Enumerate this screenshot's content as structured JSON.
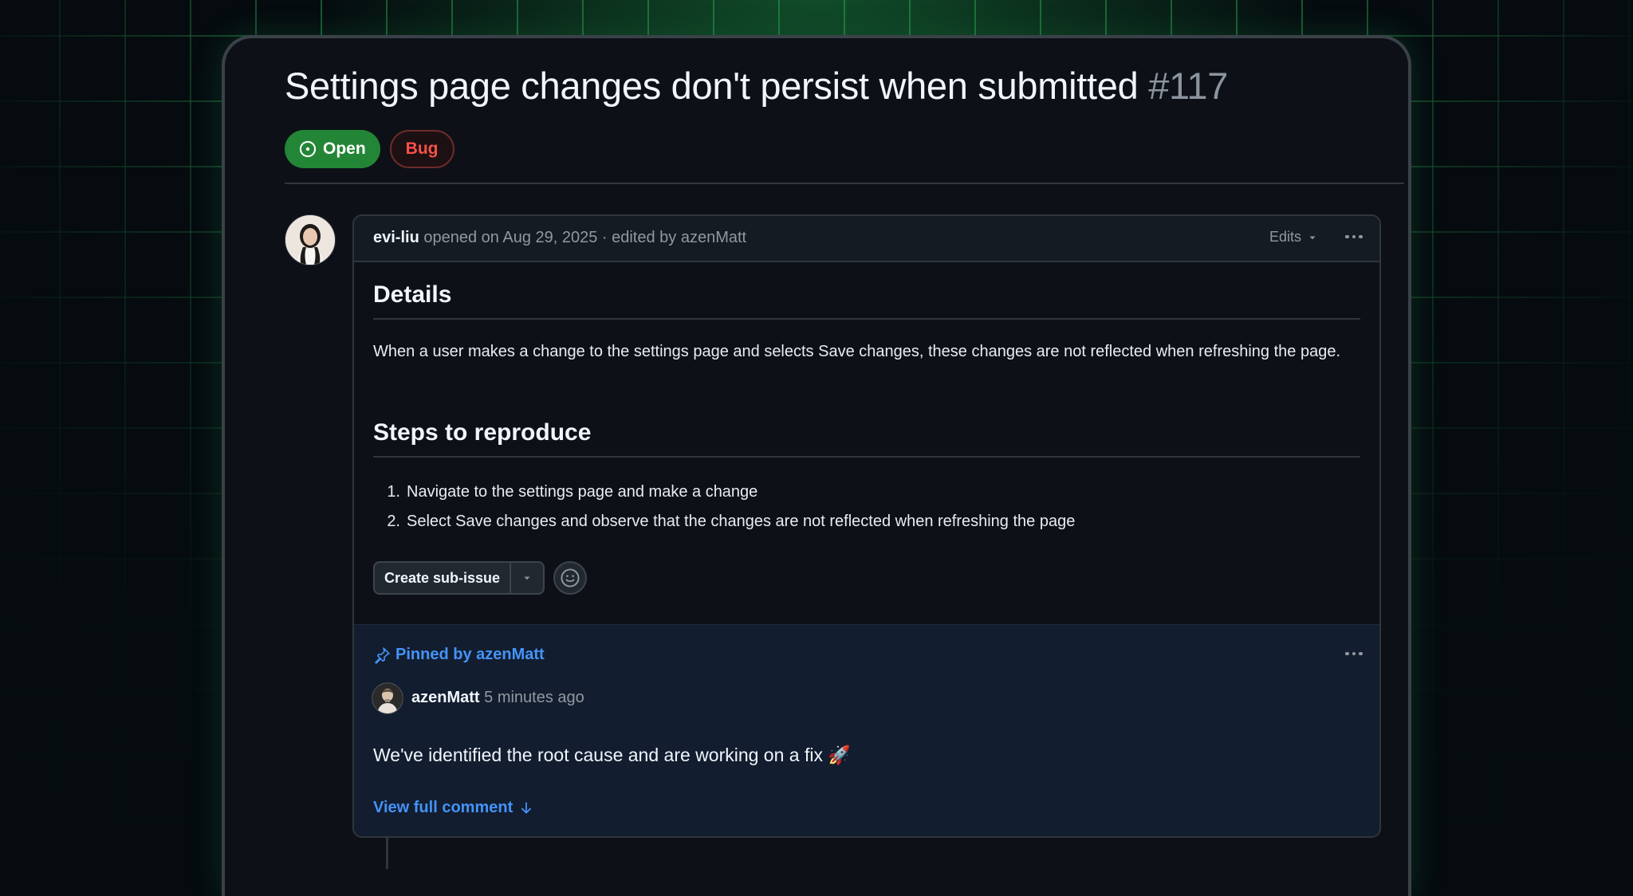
{
  "issue": {
    "title": "Settings page changes don't persist when submitted",
    "number": "#117",
    "status": "Open",
    "label": "Bug",
    "colors": {
      "open": "#238636",
      "bug": "#f85149",
      "link": "#4493f8"
    }
  },
  "post": {
    "author": "evi-liu",
    "meta": "opened on Aug 29, 2025 · edited by azenMatt",
    "edits_label": "Edits",
    "details_heading": "Details",
    "details_text": "When a user makes a change to the settings page and selects Save changes, these changes are not reflected when refreshing the page.",
    "steps_heading": "Steps to reproduce",
    "steps": [
      {
        "n": "1.",
        "text": "Navigate to the settings page and make a change"
      },
      {
        "n": "2.",
        "text": "Select Save changes and observe that the changes are not reflected when refreshing the page"
      }
    ],
    "create_subissue_label": "Create sub-issue"
  },
  "pinned": {
    "label": "Pinned by azenMatt",
    "author": "azenMatt",
    "time": "5 minutes ago",
    "text": "We've identified the root cause and are working on a fix 🚀",
    "view_link": "View full comment"
  },
  "icons": {
    "status": "issue-opened-icon",
    "pin": "pin-icon",
    "emoji": "smiley-icon",
    "more": "kebab-horizontal-icon",
    "arrow": "arrow-down-icon"
  }
}
